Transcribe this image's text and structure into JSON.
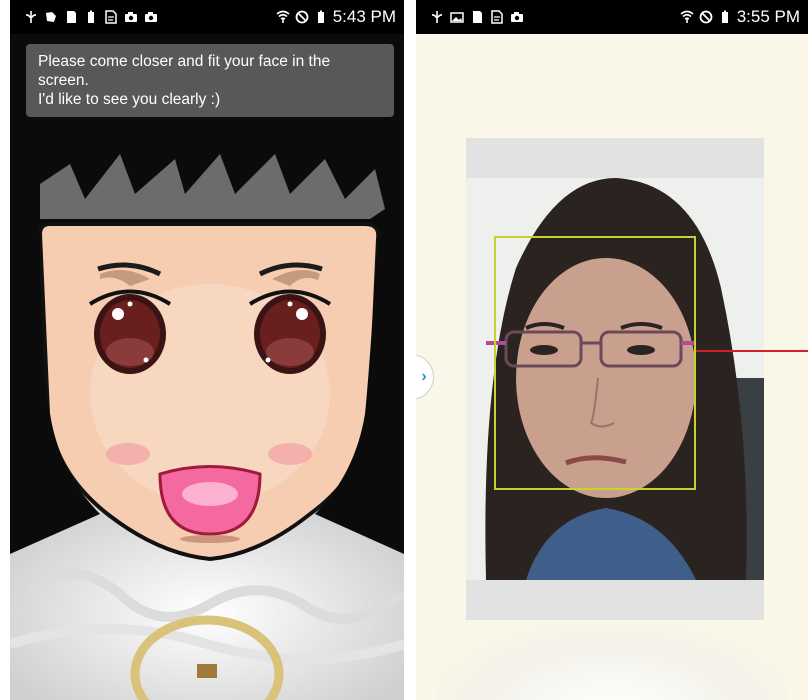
{
  "left_screen": {
    "status_bar": {
      "time": "5:43 PM",
      "notification_icons": [
        "usb-icon",
        "app-icon",
        "sd-card-icon",
        "battery-icon",
        "document-icon",
        "camera-icon",
        "camera-icon"
      ],
      "system_icons": [
        "wifi-icon",
        "no-sound-icon",
        "battery-icon"
      ]
    },
    "toast": {
      "line1": "Please come closer and fit your face in the",
      "line2": "screen.",
      "line3": "I'd like to see you clearly :)"
    }
  },
  "right_screen": {
    "status_bar": {
      "time": "3:55 PM",
      "notification_icons": [
        "usb-icon",
        "image-icon",
        "sd-card-icon",
        "document-icon",
        "camera-icon"
      ],
      "system_icons": [
        "wifi-icon",
        "no-sound-icon",
        "battery-icon"
      ]
    },
    "side_tab_icon": "›",
    "colors": {
      "face_box": "#c6d42c",
      "pointer_line": "#d11f2b"
    }
  }
}
